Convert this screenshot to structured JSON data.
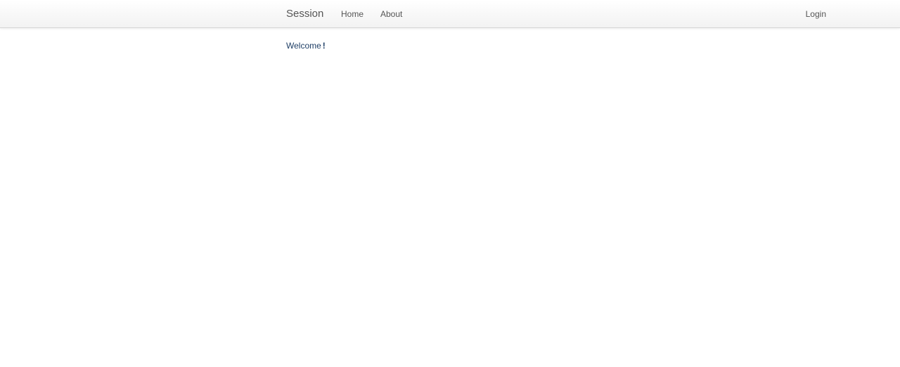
{
  "navbar": {
    "brand": "Session",
    "links": [
      {
        "label": "Home"
      },
      {
        "label": "About"
      }
    ],
    "login_label": "Login"
  },
  "main": {
    "welcome_text": "Welcome",
    "welcome_mark": "!"
  },
  "colors": {
    "navbar_text": "#555555",
    "welcome_text": "#1f3f66",
    "navbar_border": "#d4d4d4"
  }
}
